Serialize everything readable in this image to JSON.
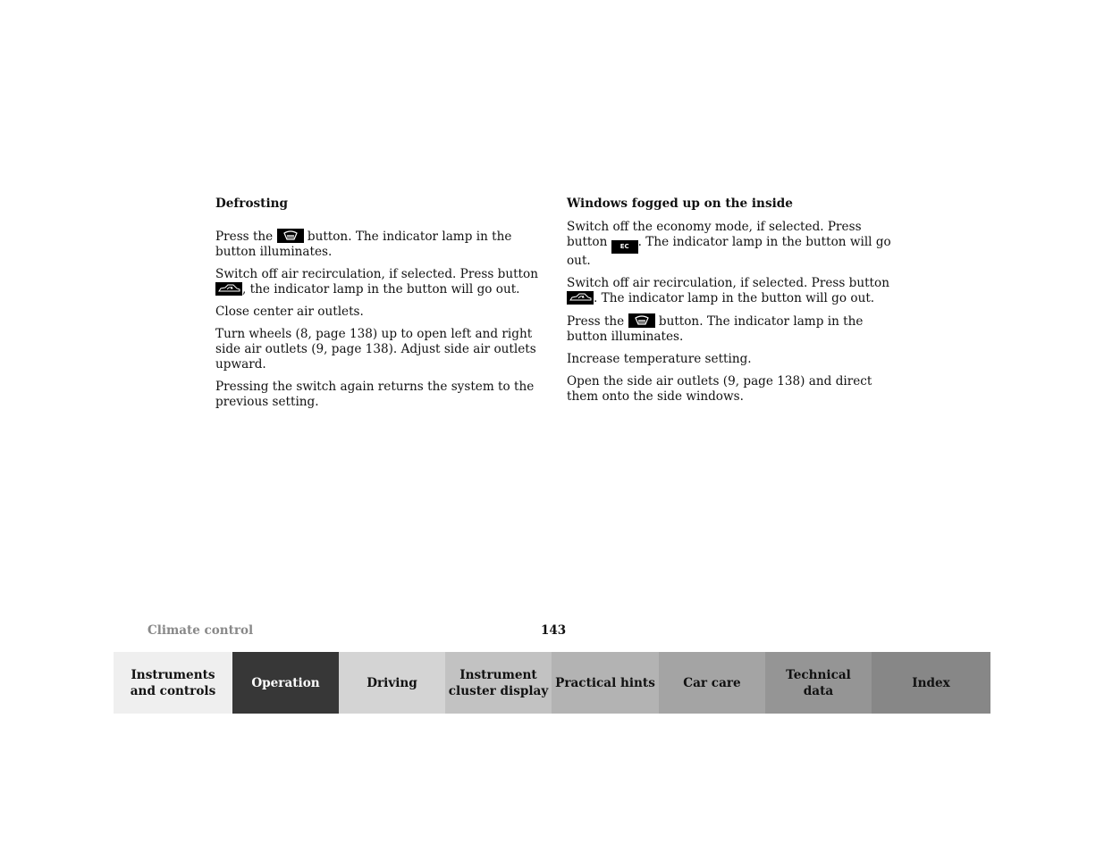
{
  "left_column": {
    "heading": "Defrosting",
    "p1_a": "Press the ",
    "p1_icon": "defrost-button-icon",
    "p1_b": " button. The indicator lamp in the button illuminates.",
    "p2_a": "Switch off air recirculation, if selected. Press button ",
    "p2_icon": "air-recirculation-button-icon",
    "p2_b": ", the indicator lamp in the button will go out.",
    "p3": "Close center air outlets.",
    "p4": "Turn wheels (8, page 138) up to open left and right side air outlets (9, page 138). Adjust side air outlets upward.",
    "p5": "Pressing the switch again returns the system to the previous setting."
  },
  "right_column": {
    "heading": "Windows fogged up on the inside",
    "p1_a": "Switch off the economy mode, if selected. Press button ",
    "p1_icon_label": "EC",
    "p1_b": ". The indicator lamp in the button will go out.",
    "p2_a": "Switch off air recirculation, if selected. Press button ",
    "p2_b": ". The indicator lamp in the button will go out.",
    "p3_a": "Press the ",
    "p3_b": " button. The indicator lamp in the button illuminates.",
    "p4": "Increase temperature setting.",
    "p5": "Open the side air outlets (9, page 138) and direct them onto the side windows."
  },
  "footer": {
    "section_title": "Climate control",
    "page_number": "143"
  },
  "nav_tabs": [
    {
      "line1": "Instruments",
      "line2": "and controls",
      "bg": "#efefef",
      "fg": "#111111"
    },
    {
      "line1": "Operation",
      "line2": "",
      "bg": "#373737",
      "fg": "#ffffff"
    },
    {
      "line1": "Driving",
      "line2": "",
      "bg": "#d4d4d4",
      "fg": "#111111"
    },
    {
      "line1": "Instrument",
      "line2": "cluster display",
      "bg": "#c2c2c2",
      "fg": "#111111"
    },
    {
      "line1": "Practical hints",
      "line2": "",
      "bg": "#b3b3b3",
      "fg": "#111111"
    },
    {
      "line1": "Car care",
      "line2": "",
      "bg": "#a4a4a4",
      "fg": "#111111"
    },
    {
      "line1": "Technical",
      "line2": "data",
      "bg": "#959595",
      "fg": "#111111"
    },
    {
      "line1": "Index",
      "line2": "",
      "bg": "#878787",
      "fg": "#111111"
    }
  ]
}
